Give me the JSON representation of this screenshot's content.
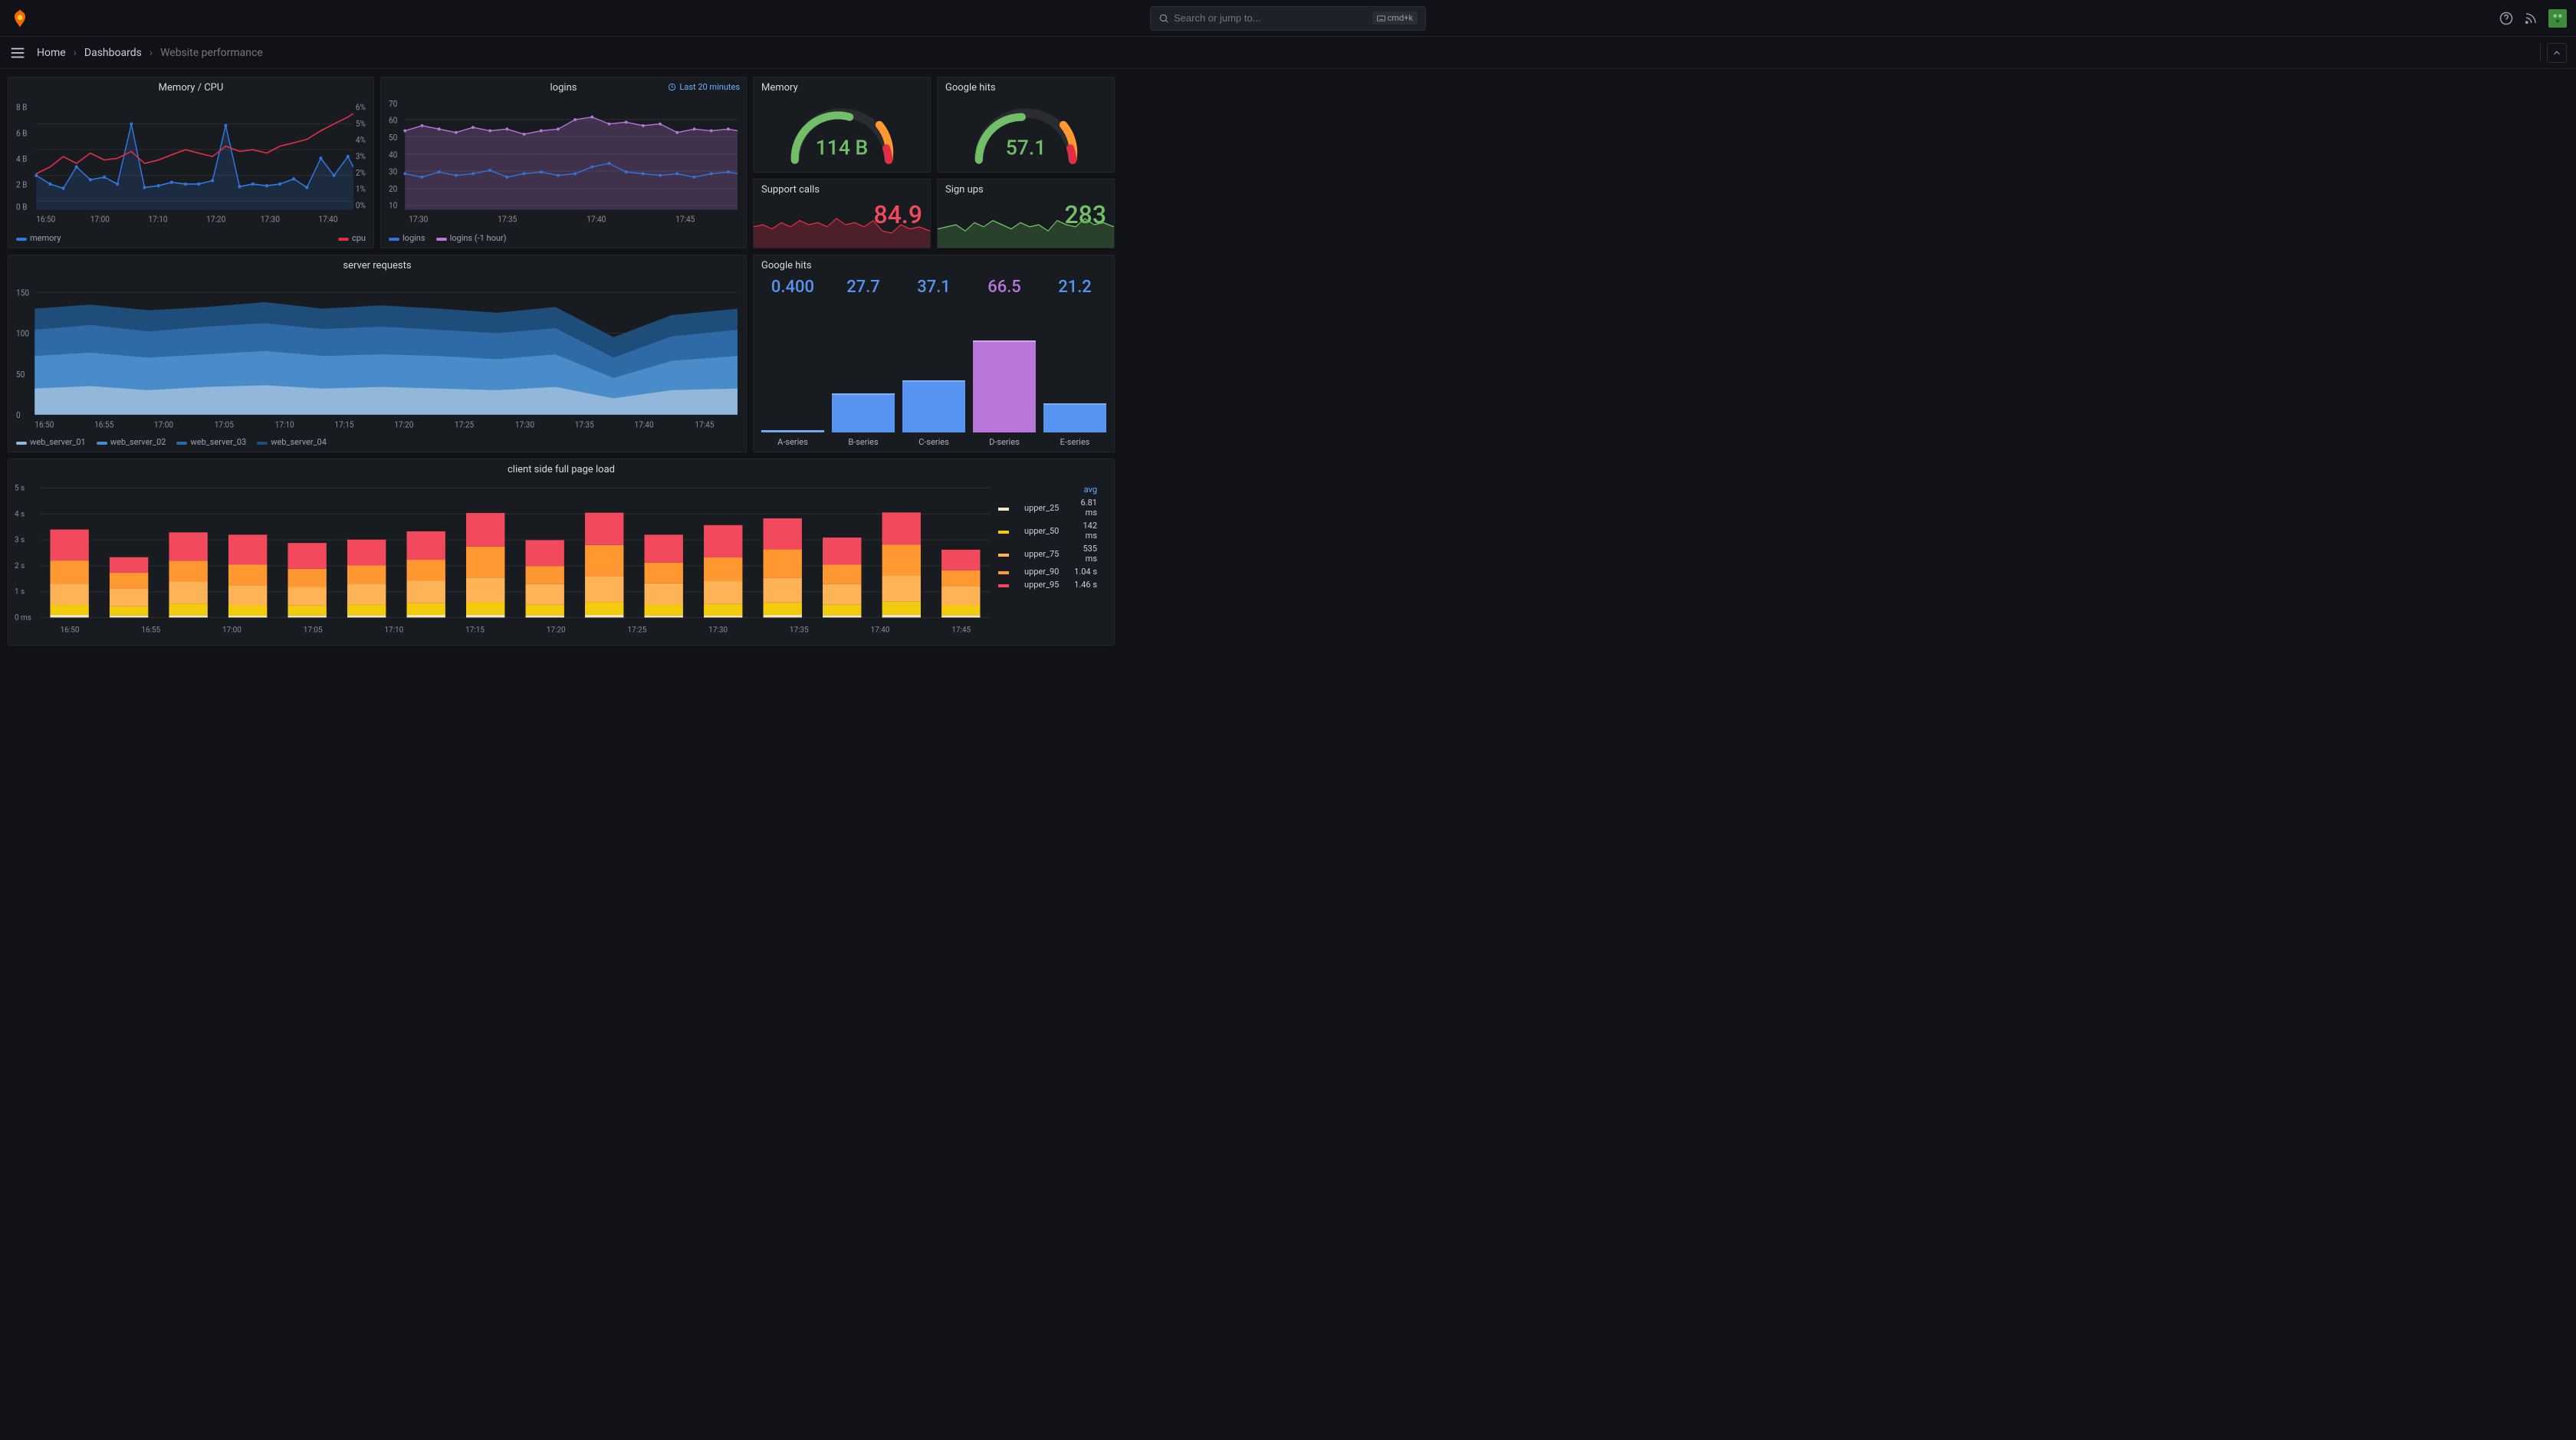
{
  "search": {
    "placeholder": "Search or jump to...",
    "shortcut": "cmd+k"
  },
  "breadcrumb": {
    "home": "Home",
    "dashboards": "Dashboards",
    "current": "Website performance"
  },
  "panels": {
    "memcpu": {
      "title": "Memory / CPU",
      "legend": [
        "memory",
        "cpu"
      ],
      "xticks": [
        "16:50",
        "17:00",
        "17:10",
        "17:20",
        "17:30",
        "17:40"
      ],
      "yticks_left": [
        "0 B",
        "2 B",
        "4 B",
        "6 B",
        "8 B"
      ],
      "yticks_right": [
        "0%",
        "1%",
        "2%",
        "3%",
        "4%",
        "5%",
        "6%"
      ]
    },
    "logins": {
      "title": "logins",
      "time_range": "Last 20 minutes",
      "legend": [
        "logins",
        "logins (-1 hour)"
      ],
      "xticks": [
        "17:30",
        "17:35",
        "17:40",
        "17:45"
      ],
      "yticks": [
        "10",
        "20",
        "30",
        "40",
        "50",
        "60",
        "70"
      ]
    },
    "memory_gauge": {
      "title": "Memory",
      "value": "114 B"
    },
    "ghits_gauge": {
      "title": "Google hits",
      "value": "57.1"
    },
    "support": {
      "title": "Support calls",
      "value": "84.9"
    },
    "signups": {
      "title": "Sign ups",
      "value": "283"
    },
    "server": {
      "title": "server requests",
      "legend": [
        "web_server_01",
        "web_server_02",
        "web_server_03",
        "web_server_04"
      ],
      "xticks": [
        "16:50",
        "16:55",
        "17:00",
        "17:05",
        "17:10",
        "17:15",
        "17:20",
        "17:25",
        "17:30",
        "17:35",
        "17:40",
        "17:45"
      ],
      "yticks": [
        "0",
        "50",
        "100",
        "150"
      ]
    },
    "ghits_bars": {
      "title": "Google hits",
      "series": [
        {
          "label": "A-series",
          "value": "0.400",
          "color": "#5794f2",
          "pct": 2
        },
        {
          "label": "B-series",
          "value": "27.7",
          "color": "#5794f2",
          "pct": 30
        },
        {
          "label": "C-series",
          "value": "37.1",
          "color": "#5794f2",
          "pct": 40
        },
        {
          "label": "D-series",
          "value": "66.5",
          "color": "#b877d9",
          "pct": 70
        },
        {
          "label": "E-series",
          "value": "21.2",
          "color": "#5794f2",
          "pct": 22
        }
      ]
    },
    "pageload": {
      "title": "client side full page load",
      "xticks": [
        "16:50",
        "16:55",
        "17:00",
        "17:05",
        "17:10",
        "17:15",
        "17:20",
        "17:25",
        "17:30",
        "17:35",
        "17:40",
        "17:45"
      ],
      "yticks": [
        "0 ms",
        "1 s",
        "2 s",
        "3 s",
        "4 s",
        "5 s"
      ],
      "legend_header": "avg",
      "legend": [
        {
          "name": "upper_25",
          "avg": "6.81 ms",
          "color": "#f2e7c4"
        },
        {
          "name": "upper_50",
          "avg": "142 ms",
          "color": "#f2cc0c"
        },
        {
          "name": "upper_75",
          "avg": "535 ms",
          "color": "#ffb357"
        },
        {
          "name": "upper_90",
          "avg": "1.04 s",
          "color": "#ff9830"
        },
        {
          "name": "upper_95",
          "avg": "1.46 s",
          "color": "#f2495c"
        }
      ]
    }
  },
  "chart_data": [
    {
      "type": "line",
      "title": "Memory / CPU",
      "x": [
        "16:50",
        "17:00",
        "17:10",
        "17:20",
        "17:30",
        "17:40"
      ],
      "series": [
        {
          "name": "memory",
          "axis": "left",
          "ylim": [
            0,
            8
          ],
          "unit": "B",
          "values": [
            2.6,
            2.0,
            1.8,
            3.0,
            2.2,
            2.4,
            2.0,
            6.1,
            1.9,
            2.1,
            2.2,
            2.0,
            2.0,
            2.3,
            6.0,
            1.9,
            2.0,
            2.1,
            2.0,
            2.5,
            1.9,
            4.1,
            2.6,
            4.2
          ]
        },
        {
          "name": "cpu",
          "axis": "right",
          "ylim": [
            0,
            6
          ],
          "unit": "%",
          "values": [
            2.2,
            2.6,
            3.2,
            2.8,
            3.4,
            3.0,
            3.1,
            3.5,
            2.9,
            3.0,
            3.3,
            3.6,
            3.4,
            3.2,
            3.8,
            3.5,
            3.6,
            3.4,
            3.8,
            4.0,
            4.2,
            4.8,
            5.2,
            5.6
          ]
        }
      ]
    },
    {
      "type": "line",
      "title": "logins",
      "x": [
        "17:30",
        "17:35",
        "17:40",
        "17:45"
      ],
      "ylim": [
        10,
        70
      ],
      "series": [
        {
          "name": "logins",
          "values": [
            30,
            28,
            31,
            29,
            30,
            32,
            28,
            30,
            31,
            29,
            30,
            33,
            35,
            31,
            30,
            29,
            30,
            28,
            30,
            31
          ]
        },
        {
          "name": "logins (-1 hour)",
          "values": [
            55,
            58,
            56,
            54,
            57,
            55,
            56,
            53,
            55,
            56,
            60,
            62,
            58,
            59,
            57,
            58,
            54,
            56,
            55,
            56
          ]
        }
      ]
    },
    {
      "type": "area",
      "title": "server requests",
      "x": [
        "16:50",
        "16:55",
        "17:00",
        "17:05",
        "17:10",
        "17:15",
        "17:20",
        "17:25",
        "17:30",
        "17:35",
        "17:40",
        "17:45"
      ],
      "ylim": [
        0,
        150
      ],
      "series": [
        {
          "name": "web_server_01",
          "values": [
            28,
            30,
            27,
            29,
            31,
            28,
            30,
            29,
            27,
            30,
            28,
            22,
            26,
            29
          ]
        },
        {
          "name": "web_server_02",
          "values": [
            26,
            28,
            25,
            27,
            29,
            26,
            28,
            27,
            25,
            28,
            26,
            17,
            24,
            27
          ]
        },
        {
          "name": "web_server_03",
          "values": [
            30,
            32,
            29,
            31,
            33,
            30,
            32,
            31,
            29,
            32,
            30,
            22,
            28,
            31
          ]
        },
        {
          "name": "web_server_04",
          "values": [
            31,
            34,
            30,
            33,
            35,
            31,
            33,
            32,
            30,
            33,
            31,
            22,
            29,
            32
          ]
        }
      ],
      "stacked": true
    },
    {
      "type": "bar",
      "title": "Google hits",
      "categories": [
        "A-series",
        "B-series",
        "C-series",
        "D-series",
        "E-series"
      ],
      "values": [
        0.4,
        27.7,
        37.1,
        66.5,
        21.2
      ]
    },
    {
      "type": "bar",
      "title": "client side full page load",
      "x": [
        "16:50",
        "16:55",
        "17:00",
        "17:05",
        "17:10",
        "17:15",
        "17:20",
        "17:25",
        "17:30",
        "17:35",
        "17:40",
        "17:45"
      ],
      "ylim": [
        0,
        5
      ],
      "yunit": "s",
      "stacked": true,
      "series": [
        {
          "name": "upper_25",
          "values": [
            0.1,
            0.08,
            0.09,
            0.07,
            0.08,
            0.09,
            0.1,
            0.11,
            0.09,
            0.1,
            0.08,
            0.07,
            0.1,
            0.09,
            0.11,
            0.09
          ]
        },
        {
          "name": "upper_50",
          "values": [
            0.4,
            0.35,
            0.45,
            0.4,
            0.38,
            0.42,
            0.45,
            0.48,
            0.4,
            0.5,
            0.42,
            0.45,
            0.48,
            0.4,
            0.5,
            0.38
          ]
        },
        {
          "name": "upper_75",
          "values": [
            0.8,
            0.7,
            0.85,
            0.78,
            0.72,
            0.8,
            0.88,
            0.95,
            0.8,
            1.0,
            0.82,
            0.9,
            0.95,
            0.8,
            1.0,
            0.75
          ]
        },
        {
          "name": "upper_90",
          "values": [
            0.9,
            0.6,
            0.8,
            0.8,
            0.7,
            0.7,
            0.8,
            1.2,
            0.7,
            1.2,
            0.8,
            0.9,
            1.1,
            0.75,
            1.2,
            0.6
          ]
        },
        {
          "name": "upper_95",
          "values": [
            1.2,
            0.6,
            1.1,
            1.15,
            1.0,
            1.0,
            1.1,
            1.3,
            1.0,
            1.25,
            1.08,
            1.25,
            1.2,
            1.05,
            1.25,
            0.8
          ]
        }
      ]
    }
  ]
}
